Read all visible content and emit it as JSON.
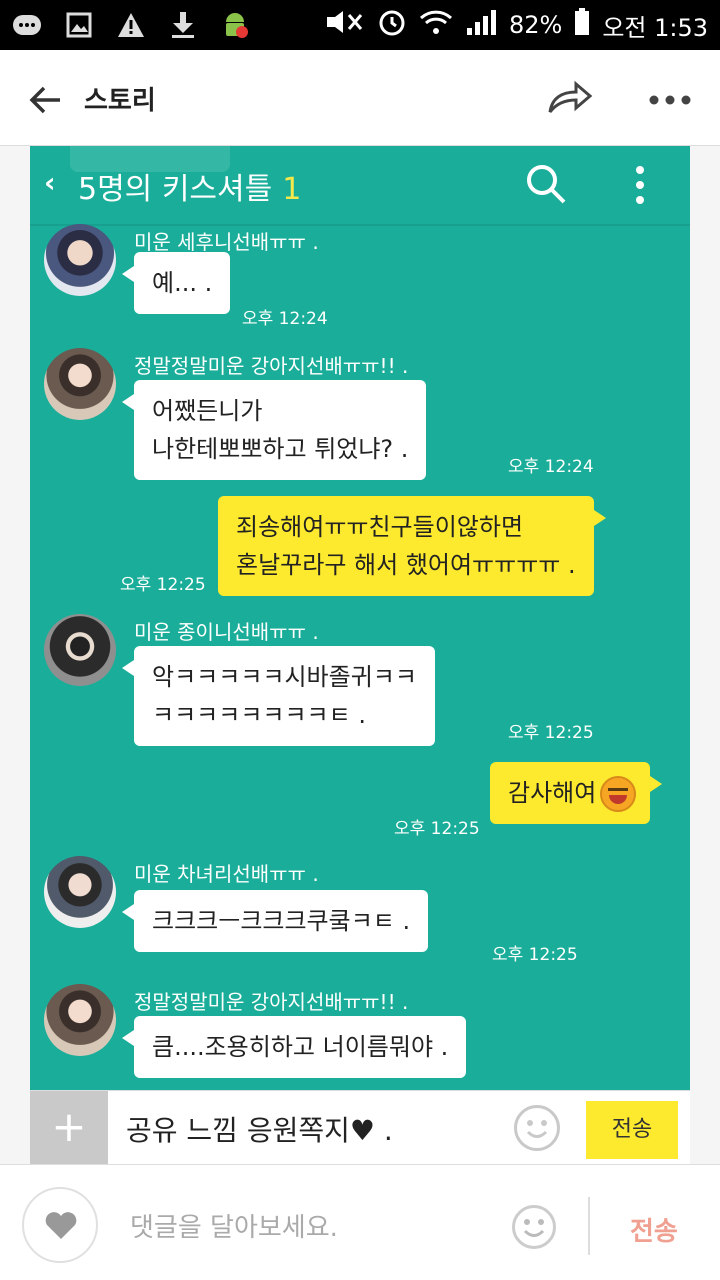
{
  "status_bar": {
    "battery": "82%",
    "time": "오전 1:53"
  },
  "app_bar": {
    "title": "스토리"
  },
  "chat": {
    "room_name": "5명의 키스셔틀",
    "room_count": "1",
    "messages": [
      {
        "sender": "미운 세후니선배ㅠㅠ .",
        "text": "예... .",
        "time": "오후 12:24"
      },
      {
        "sender": "정말정말미운 강아지선배ㅠㅠ!! .",
        "text": "어쨌든니가\n나한테뽀뽀하고 튀었냐? .",
        "time": "오후 12:24"
      },
      {
        "sender": "",
        "text": "죄송해여ㅠㅠ친구들이않하면\n혼날꾸라구 해서 했어여ㅠㅠㅠㅠ .",
        "time": "오후 12:25"
      },
      {
        "sender": "미운 종이니선배ㅠㅠ .",
        "text": "악ㅋㅋㅋㅋㅋ시바졸귀ㅋㅋ\nㅋㅋㅋㅋㅋㅋㅋㅋㅌ .",
        "time": "오후 12:25"
      },
      {
        "sender": "",
        "text": "감사해여",
        "time": "오후 12:25"
      },
      {
        "sender": "미운 차녀리선배ㅠㅠ .",
        "text": "크크크ㅡ크크크쿠쿸ㅋㅌ .",
        "time": "오후 12:25"
      },
      {
        "sender": "정말정말미운 강아지선배ㅠㅠ!! .",
        "text": "큼....조용히하고 너이름뭐야 .",
        "time": ""
      }
    ],
    "composer_text": "공유 느낌 응원쪽지♥ .",
    "send_label": "전송"
  },
  "comment_bar": {
    "placeholder": "댓글을 달아보세요.",
    "send_label": "전송"
  },
  "colors": {
    "chat_bg": "#1aae9a",
    "my_bubble": "#fdea2e",
    "comment_send": "#f0a090"
  }
}
